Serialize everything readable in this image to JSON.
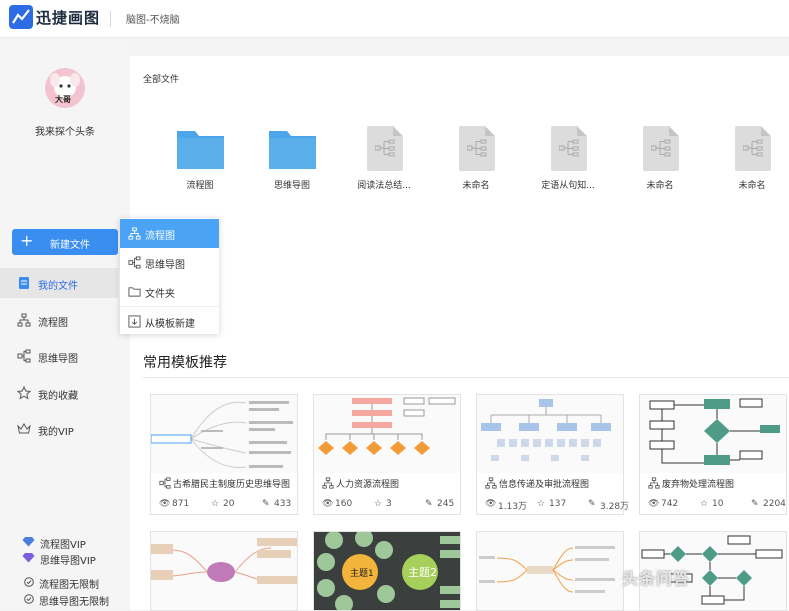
{
  "app": {
    "name": "迅捷画图",
    "doc_title": "脑图-不烧脑"
  },
  "user": {
    "name": "我来探个头条",
    "avatar_text": "大哥"
  },
  "sidebar": {
    "new_button": "新建文件",
    "items": [
      {
        "label": "我的文件",
        "icon": "file-icon",
        "active": true
      },
      {
        "label": "流程图",
        "icon": "flowchart-icon"
      },
      {
        "label": "思维导图",
        "icon": "mindmap-icon"
      },
      {
        "label": "我的收藏",
        "icon": "star-icon"
      },
      {
        "label": "我的VIP",
        "icon": "crown-icon"
      }
    ],
    "vip": [
      {
        "label": "流程图VIP",
        "icon": "diamond-icon"
      },
      {
        "label": "思维导图VIP",
        "icon": "diamond-icon"
      },
      {
        "label": "流程图无限制",
        "icon": "check-circle-icon"
      },
      {
        "label": "思维导图无限制",
        "icon": "check-circle-icon"
      }
    ]
  },
  "new_menu": {
    "items": [
      {
        "label": "流程图",
        "icon": "flowchart-icon"
      },
      {
        "label": "思维导图",
        "icon": "mindmap-icon"
      },
      {
        "label": "文件夹",
        "icon": "folder-icon"
      },
      {
        "label": "从模板新建",
        "icon": "template-icon"
      }
    ]
  },
  "files": {
    "section_label": "全部文件",
    "items": [
      {
        "name": "流程图",
        "type": "folder"
      },
      {
        "name": "思维导图",
        "type": "folder"
      },
      {
        "name": "阅读法总结...",
        "type": "mindmap"
      },
      {
        "name": "未命名",
        "type": "mindmap"
      },
      {
        "name": "定语从句知...",
        "type": "mindmap"
      },
      {
        "name": "未命名",
        "type": "mindmap"
      },
      {
        "name": "未命名",
        "type": "mindmap"
      }
    ]
  },
  "templates": {
    "title": "常用模板推荐",
    "cards": [
      {
        "name": "古希腊民主制度历史思维导图",
        "icon": "mindmap-icon",
        "views": "871",
        "stars": "20",
        "uses": "433"
      },
      {
        "name": "人力资源流程图",
        "icon": "flowchart-icon",
        "views": "160",
        "stars": "3",
        "uses": "245"
      },
      {
        "name": "信息传递及审批流程图",
        "icon": "flowchart-icon",
        "views": "1.13万",
        "stars": "137",
        "uses": "3.28万"
      },
      {
        "name": "废弃物处理流程图",
        "icon": "flowchart-icon",
        "views": "742",
        "stars": "10",
        "uses": "2204"
      }
    ],
    "row2_labels": [
      "主题1",
      "主题2"
    ]
  },
  "watermark": "头条问答",
  "colors": {
    "accent": "#3a8ef0",
    "menu_active": "#4aa3f4",
    "folder": "#5aaee9",
    "doc": "#dcdcdc",
    "green_box": "#4e9c87",
    "orange": "#f29c38"
  }
}
